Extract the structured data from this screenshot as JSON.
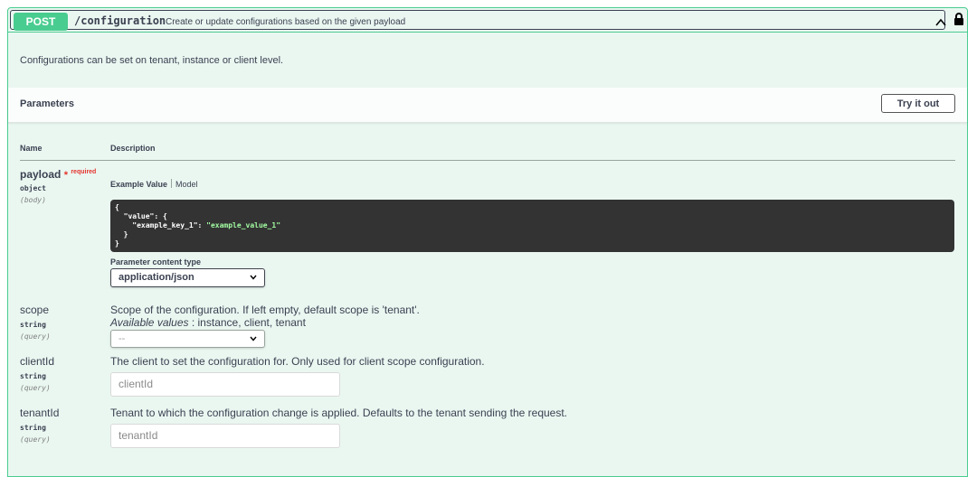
{
  "operation": {
    "method": "POST",
    "path": "/configuration",
    "summary": "Create or update configurations based on the given payload",
    "description": "Configurations can be set on tenant, instance or client level.",
    "method_color": "#49cc90"
  },
  "parameters_section": {
    "title": "Parameters",
    "try_button": "Try it out",
    "col_name": "Name",
    "col_description": "Description"
  },
  "payload": {
    "name": "payload",
    "required_star": "*",
    "required_label": "required",
    "type": "object",
    "in": "(body)",
    "tab_example": "Example Value",
    "tab_model": "Model",
    "code_line1": "{",
    "code_line2": "  \"value\": {",
    "code_line3_key": "    \"example_key_1\": ",
    "code_line3_val": "\"example_value_1\"",
    "code_line4": "  }",
    "code_line5": "}",
    "content_type_label": "Parameter content type",
    "content_type_value": "application/json"
  },
  "scope": {
    "name": "scope",
    "type": "string",
    "in": "(query)",
    "description": "Scope of the configuration. If left empty, default scope is 'tenant'.",
    "available_label": "Available values",
    "available_values": " : instance, client, tenant",
    "select_value": "--"
  },
  "clientId": {
    "name": "clientId",
    "type": "string",
    "in": "(query)",
    "description": "The client to set the configuration for. Only used for client scope configuration.",
    "placeholder": "clientId"
  },
  "tenantId": {
    "name": "tenantId",
    "type": "string",
    "in": "(query)",
    "description": "Tenant to which the configuration change is applied. Defaults to the tenant sending the request.",
    "placeholder": "tenantId"
  },
  "icons": {
    "collapse": "chevron-up-icon",
    "lock": "lock-icon",
    "dropdown": "chevron-down-icon"
  }
}
